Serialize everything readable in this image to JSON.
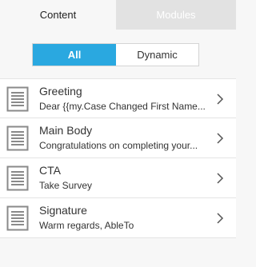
{
  "tabs": [
    {
      "label": "Content",
      "active": true
    },
    {
      "label": "Modules",
      "active": false
    }
  ],
  "filter": {
    "options": [
      "All",
      "Dynamic"
    ],
    "selected": "All",
    "accent_color": "#2aa8e0"
  },
  "items": [
    {
      "title": "Greeting",
      "subtitle": "Dear {{my.Case Changed First Name...",
      "icon": "document-icon"
    },
    {
      "title": "Main Body",
      "subtitle": "Congratulations on completing your...",
      "icon": "document-icon"
    },
    {
      "title": "CTA",
      "subtitle": "Take Survey",
      "icon": "document-icon"
    },
    {
      "title": "Signature",
      "subtitle": "Warm regards, AbleTo",
      "icon": "document-icon"
    }
  ]
}
